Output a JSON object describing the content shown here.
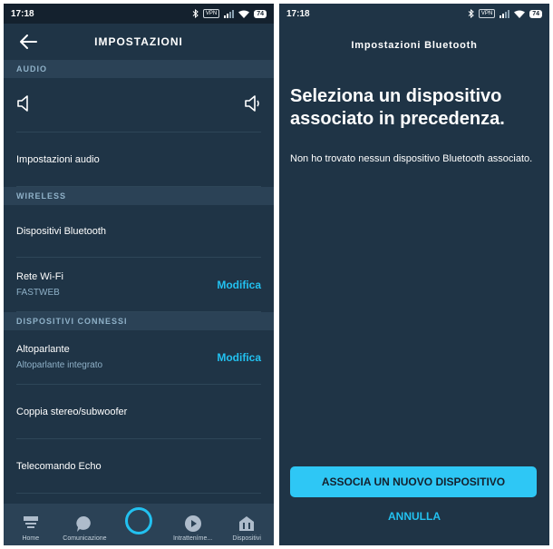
{
  "left": {
    "status": {
      "time": "17:18",
      "vpn": "VPN",
      "battery": "74"
    },
    "header": {
      "title": "IMPOSTAZIONI"
    },
    "sections": {
      "audio": "AUDIO",
      "wireless": "WIRELESS",
      "connected": "DISPOSITIVI CONNESSI"
    },
    "items": {
      "audio_settings": "Impostazioni audio",
      "bluetooth": "Dispositivi Bluetooth",
      "wifi": {
        "label": "Rete Wi-Fi",
        "value": "FASTWEB",
        "action": "Modifica"
      },
      "speaker": {
        "label": "Altoparlante",
        "value": "Altoparlante integrato",
        "action": "Modifica"
      },
      "stereo": "Coppia stereo/subwoofer",
      "remote": "Telecomando Echo"
    },
    "nav": {
      "home": "Home",
      "comm": "Comunicazione",
      "entertainment": "Intratteníme...",
      "devices": "Dispositivi"
    }
  },
  "right": {
    "status": {
      "time": "17:18",
      "vpn": "VPN",
      "battery": "74"
    },
    "title": "Impostazioni Bluetooth",
    "heading": "Seleziona un dispositivo associato in precedenza.",
    "body": "Non ho trovato nessun dispositivo Bluetooth associato.",
    "primary_button": "ASSOCIA UN NUOVO DISPOSITIVO",
    "cancel": "ANNULLA"
  },
  "colors": {
    "background": "#1f3446",
    "section": "#2b4256",
    "accent": "#22c1f0",
    "muted": "#8fb1c8"
  }
}
